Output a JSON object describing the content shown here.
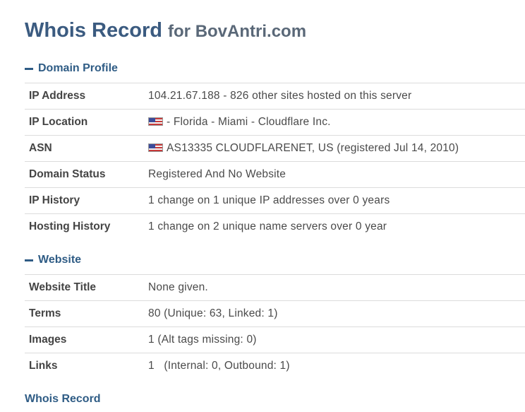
{
  "header": {
    "title_main": "Whois Record",
    "title_for": "for BovAntri.com"
  },
  "domain_profile": {
    "heading": "Domain Profile",
    "rows": [
      {
        "label": "IP Address",
        "value": "104.21.67.188 - 826 other sites hosted on this server",
        "flag": false
      },
      {
        "label": "IP Location",
        "value": "- Florida - Miami - Cloudflare Inc.",
        "flag": true
      },
      {
        "label": "ASN",
        "value": "AS13335 CLOUDFLARENET, US (registered Jul 14, 2010)",
        "flag": true
      },
      {
        "label": "Domain Status",
        "value": "Registered And No Website",
        "flag": false
      },
      {
        "label": "IP History",
        "value": "1 change on 1 unique IP addresses over 0 years",
        "flag": false
      },
      {
        "label": "Hosting History",
        "value": "1 change on 2 unique name servers over 0 year",
        "flag": false
      }
    ]
  },
  "website": {
    "heading": "Website",
    "rows": [
      {
        "label": "Website Title",
        "value": "None given."
      },
      {
        "label": "Terms",
        "value": "80 (Unique: 63, Linked: 1)"
      },
      {
        "label": "Images",
        "value": "1 (Alt tags missing: 0)"
      },
      {
        "label": "Links",
        "value": "1   (Internal: 0, Outbound: 1)"
      }
    ]
  },
  "whois_record": {
    "heading": "Whois Record"
  },
  "icons": {
    "collapse": "minus-icon",
    "flag": "us-flag-icon"
  }
}
